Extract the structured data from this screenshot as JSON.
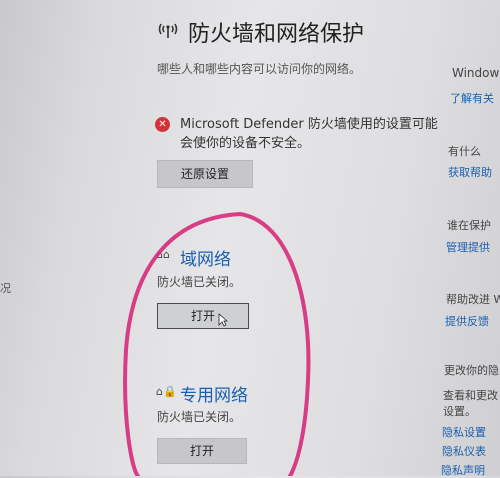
{
  "header": {
    "title": "防火墙和网络保护",
    "subtitle": "哪些人和哪些内容可以访问你的网络。"
  },
  "warning": {
    "text": "Microsoft Defender 防火墙使用的设置可能会使你的设备不安全。",
    "restore_label": "还原设置"
  },
  "networks": [
    {
      "name": "域网络",
      "status": "防火墙已关闭。",
      "button": "打开"
    },
    {
      "name": "专用网络",
      "status": "防火墙已关闭。",
      "button": "打开"
    }
  ],
  "side": {
    "windows": "Windows",
    "windows_link": "了解有关",
    "help_heading": "有什么",
    "help_link": "获取帮助",
    "protect_heading": "谁在保护",
    "protect_link": "管理提供",
    "improve_heading": "帮助改进 W",
    "improve_link": "提供反馈",
    "privacy_heading": "更改你的隐",
    "privacy_text1": "查看和更改",
    "privacy_text2": "设置。",
    "privacy_link1": "隐私设置",
    "privacy_link2": "隐私仪表",
    "privacy_link3": "隐私声明"
  },
  "left_fragment": "况",
  "colors": {
    "link": "#1a5fb0",
    "error": "#d13438",
    "annotation": "#d62a7a"
  }
}
